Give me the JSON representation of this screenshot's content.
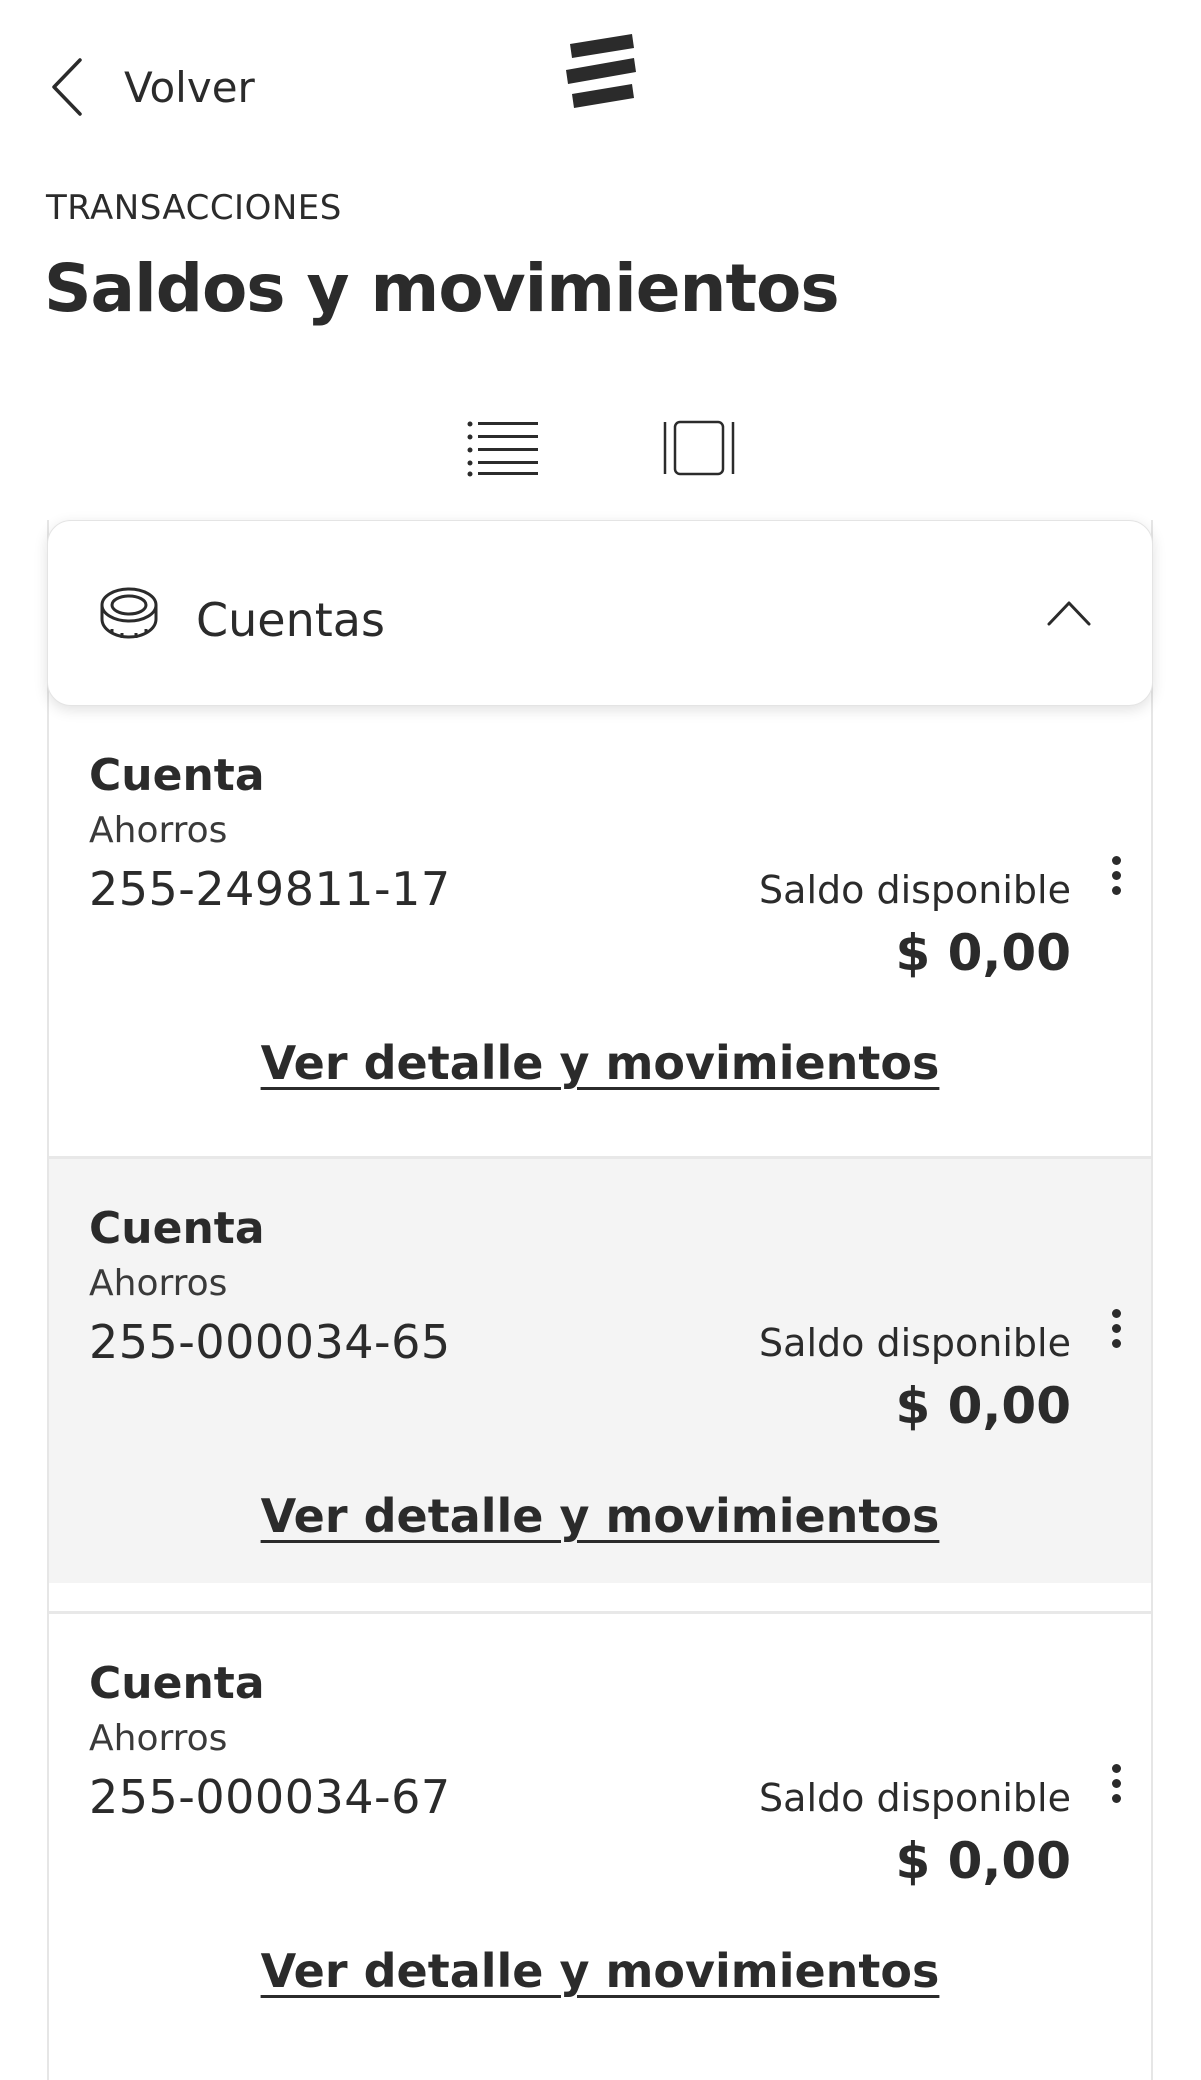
{
  "header": {
    "back_label": "Volver",
    "logo_icon": "bancolombia-logo-icon"
  },
  "page": {
    "eyebrow": "TRANSACCIONES",
    "title": "Saldos y movimientos"
  },
  "view_toggle": {
    "list_icon": "list-view-icon",
    "card_icon": "card-view-icon",
    "active": "list"
  },
  "accounts_section": {
    "title": "Cuentas",
    "icon": "coin-icon",
    "expanded": true
  },
  "accounts": [
    {
      "title": "Cuenta",
      "type": "Ahorros",
      "number": "255-249811-17",
      "balance_label": "Saldo disponible",
      "balance": "$ 0,00",
      "link": "Ver detalle y movimientos"
    },
    {
      "title": "Cuenta",
      "type": "Ahorros",
      "number": "255-000034-65",
      "balance_label": "Saldo disponible",
      "balance": "$ 0,00",
      "link": "Ver detalle y movimientos"
    },
    {
      "title": "Cuenta",
      "type": "Ahorros",
      "number": "255-000034-67",
      "balance_label": "Saldo disponible",
      "balance": "$ 0,00",
      "link": "Ver detalle y movimientos"
    }
  ],
  "colors": {
    "text": "#2b2b2b",
    "alt_row": "#f4f4f4",
    "divider": "#e8e8e8"
  }
}
